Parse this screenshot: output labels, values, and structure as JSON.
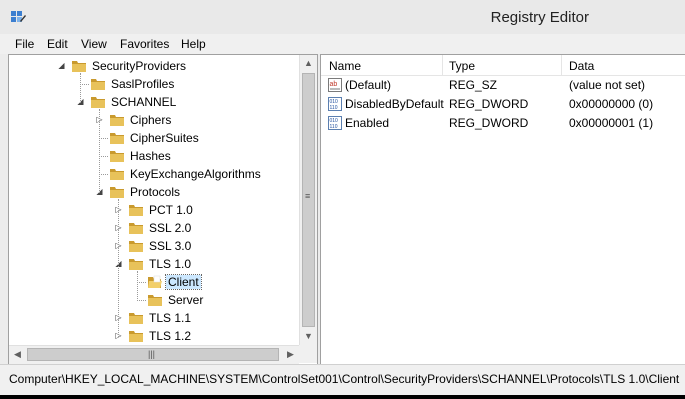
{
  "window": {
    "title": "Registry Editor",
    "app_icon": "regedit-icon"
  },
  "menu": [
    "File",
    "Edit",
    "View",
    "Favorites",
    "Help"
  ],
  "tree": {
    "nodes": [
      {
        "label": "SecurityProviders",
        "level": 0,
        "expander": "expanded"
      },
      {
        "label": "SaslProfiles",
        "level": 1,
        "expander": "none"
      },
      {
        "label": "SCHANNEL",
        "level": 1,
        "expander": "expanded"
      },
      {
        "label": "Ciphers",
        "level": 2,
        "expander": "collapsed"
      },
      {
        "label": "CipherSuites",
        "level": 2,
        "expander": "none"
      },
      {
        "label": "Hashes",
        "level": 2,
        "expander": "none"
      },
      {
        "label": "KeyExchangeAlgorithms",
        "level": 2,
        "expander": "none"
      },
      {
        "label": "Protocols",
        "level": 2,
        "expander": "expanded"
      },
      {
        "label": "PCT 1.0",
        "level": 3,
        "expander": "collapsed"
      },
      {
        "label": "SSL 2.0",
        "level": 3,
        "expander": "collapsed"
      },
      {
        "label": "SSL 3.0",
        "level": 3,
        "expander": "collapsed"
      },
      {
        "label": "TLS 1.0",
        "level": 3,
        "expander": "expanded"
      },
      {
        "label": "Client",
        "level": 4,
        "expander": "none",
        "selected": true,
        "open": true
      },
      {
        "label": "Server",
        "level": 4,
        "expander": "none"
      },
      {
        "label": "TLS 1.1",
        "level": 3,
        "expander": "collapsed"
      },
      {
        "label": "TLS 1.2",
        "level": 3,
        "expander": "collapsed"
      }
    ]
  },
  "list": {
    "columns": [
      "Name",
      "Type",
      "Data"
    ],
    "rows": [
      {
        "icon": "string-value-icon",
        "name": "(Default)",
        "type": "REG_SZ",
        "data": "(value not set)"
      },
      {
        "icon": "binary-value-icon",
        "name": "DisabledByDefault",
        "type": "REG_DWORD",
        "data": "0x00000000 (0)"
      },
      {
        "icon": "binary-value-icon",
        "name": "Enabled",
        "type": "REG_DWORD",
        "data": "0x00000001 (1)"
      }
    ]
  },
  "status": {
    "path": "Computer\\HKEY_LOCAL_MACHINE\\SYSTEM\\ControlSet001\\Control\\SecurityProviders\\SCHANNEL\\Protocols\\TLS 1.0\\Client"
  },
  "colors": {
    "folder": "#e8c25a",
    "folder_dark": "#c99a2e",
    "selection": "#cce8ff"
  }
}
